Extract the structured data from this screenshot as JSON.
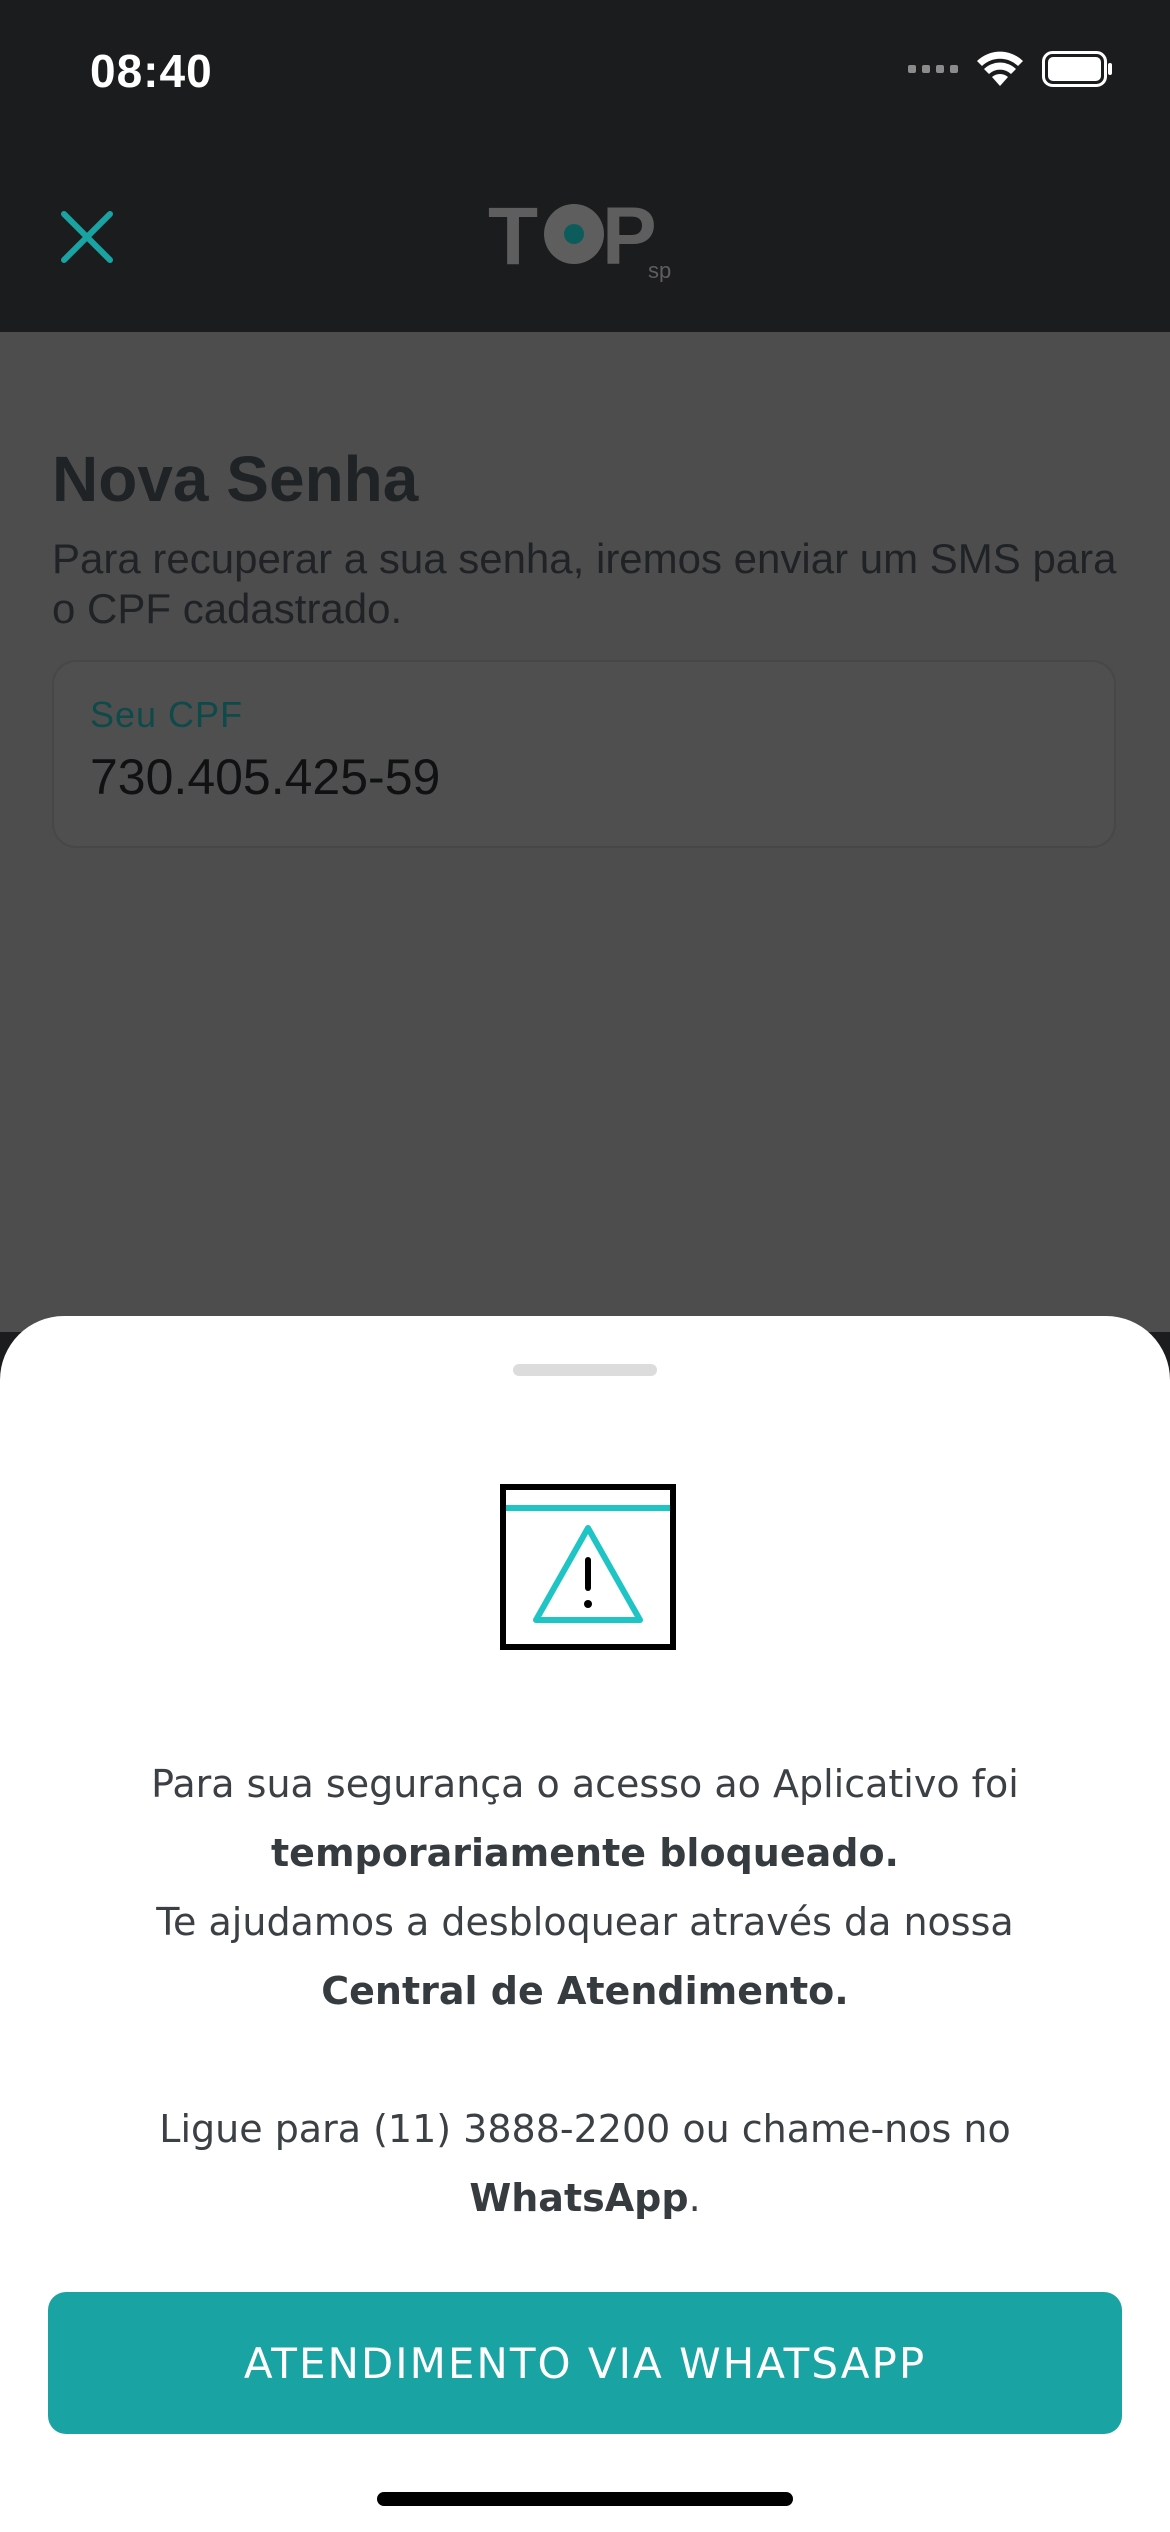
{
  "status_bar": {
    "time": "08:40"
  },
  "header": {
    "logo_text": "TOP",
    "logo_sub": "sp"
  },
  "form": {
    "title": "Nova Senha",
    "subtitle": "Para recuperar a sua senha, iremos enviar um SMS para o CPF cadastrado.",
    "cpf_label": "Seu CPF",
    "cpf_value": "730.405.425-59"
  },
  "sheet": {
    "line1": "Para sua segurança o acesso ao Aplicativo foi",
    "line2_bold": "temporariamente bloqueado.",
    "line3": "Te ajudamos a desbloquear através da nossa",
    "line4_bold": "Central de Atendimento.",
    "line5": "Ligue para (11) 3888-2200 ou chame-nos no",
    "line6_bold": "WhatsApp",
    "line6_end": ".",
    "button_label": "ATENDIMENTO VIA WHATSAPP"
  },
  "colors": {
    "accent": "#1aa3a3",
    "dark": "#1b1c1d",
    "overlay": "#4d4d4d"
  }
}
